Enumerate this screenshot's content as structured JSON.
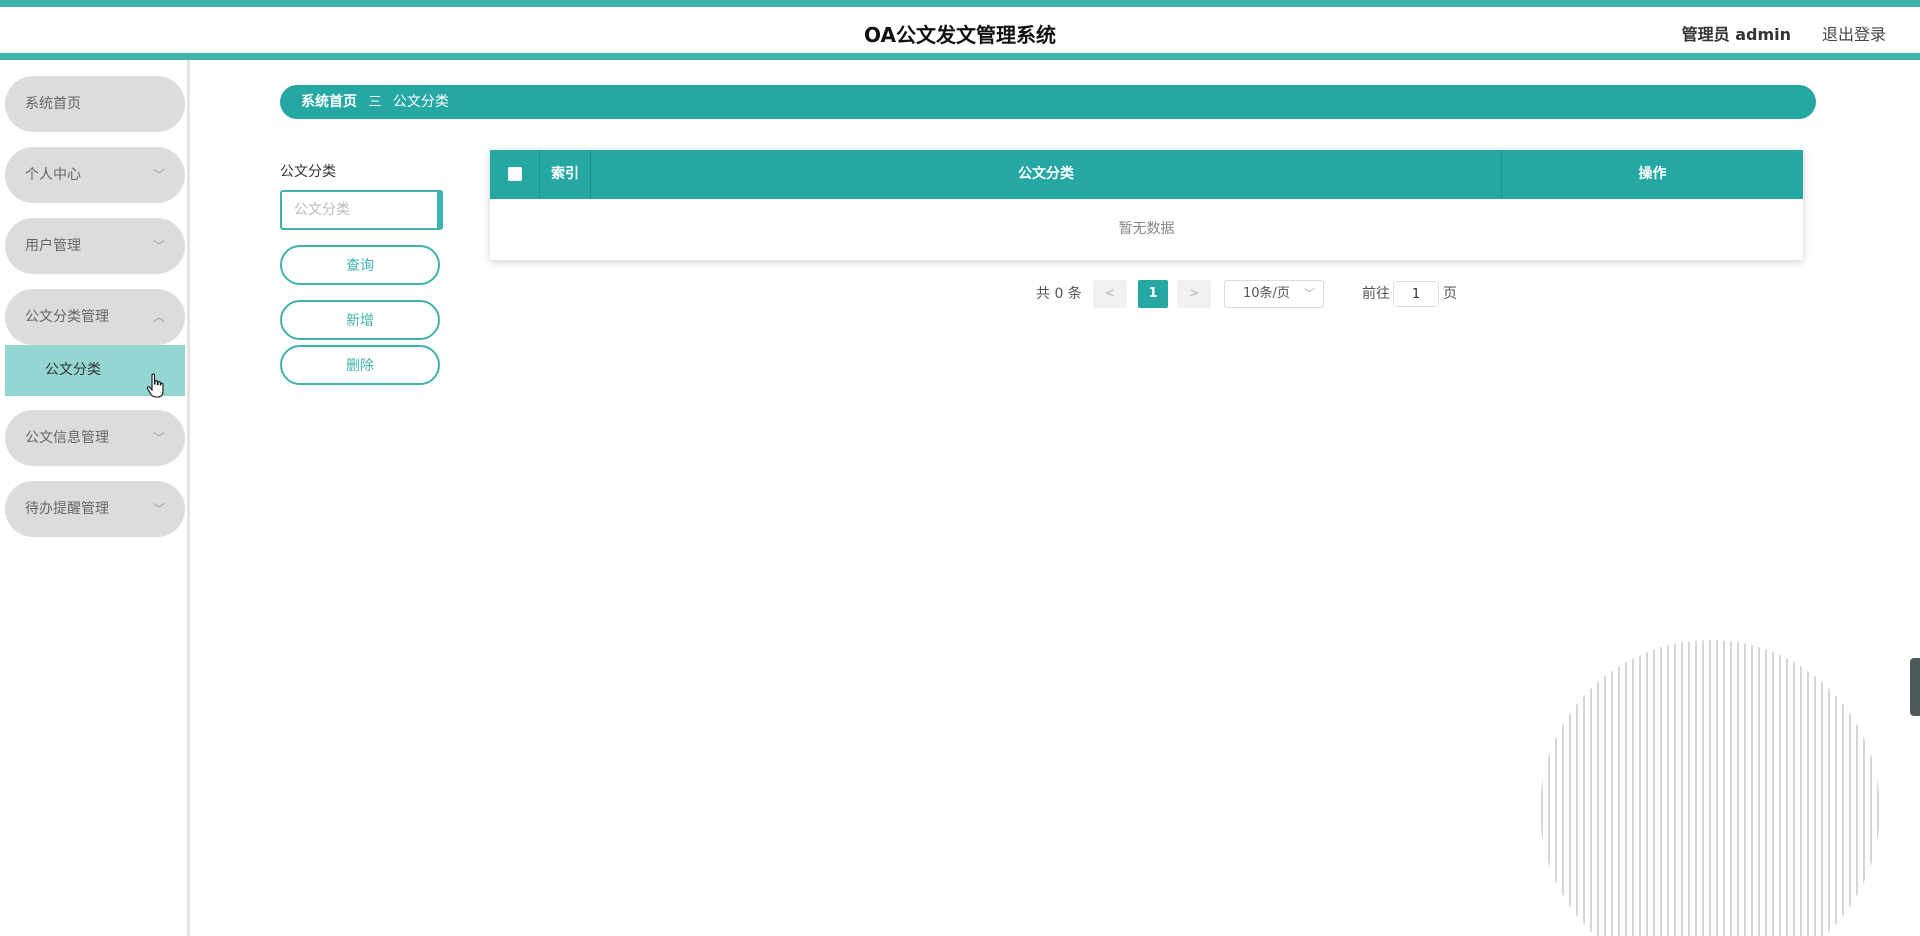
{
  "header": {
    "app_title": "OA公文发文管理系统",
    "admin_label": "管理员 admin",
    "logout_label": "退出登录"
  },
  "sidebar": {
    "items": [
      {
        "label": "系统首页",
        "has_chevron": false
      },
      {
        "label": "个人中心",
        "has_chevron": true,
        "chevron": "﹀"
      },
      {
        "label": "用户管理",
        "has_chevron": true,
        "chevron": "﹀"
      },
      {
        "label": "公文分类管理",
        "has_chevron": true,
        "chevron": "︿",
        "expanded": true
      },
      {
        "label": "公文信息管理",
        "has_chevron": true,
        "chevron": "﹀"
      },
      {
        "label": "待办提醒管理",
        "has_chevron": true,
        "chevron": "﹀"
      }
    ],
    "sub_item": {
      "label": "公文分类",
      "active": true
    }
  },
  "breadcrumb": {
    "home": "系统首页",
    "separator": "三",
    "current": "公文分类"
  },
  "filter": {
    "label": "公文分类",
    "placeholder": "公文分类",
    "value": ""
  },
  "buttons": {
    "query": "查询",
    "add": "新增",
    "delete": "删除"
  },
  "table": {
    "columns": [
      "索引",
      "公文分类",
      "操作"
    ],
    "rows": [],
    "empty_text": "暂无数据"
  },
  "pagination": {
    "total_text": "共 0 条",
    "prev": "<",
    "next": ">",
    "current_page": "1",
    "page_size": "10条/页",
    "goto_label": "前往",
    "goto_value": "1",
    "page_unit": "页"
  },
  "colors": {
    "accent": "#25a7a4",
    "accent_border": "#3fb3aa",
    "nav_bg": "#dcdcdc",
    "nav_active": "#93d6d2"
  }
}
